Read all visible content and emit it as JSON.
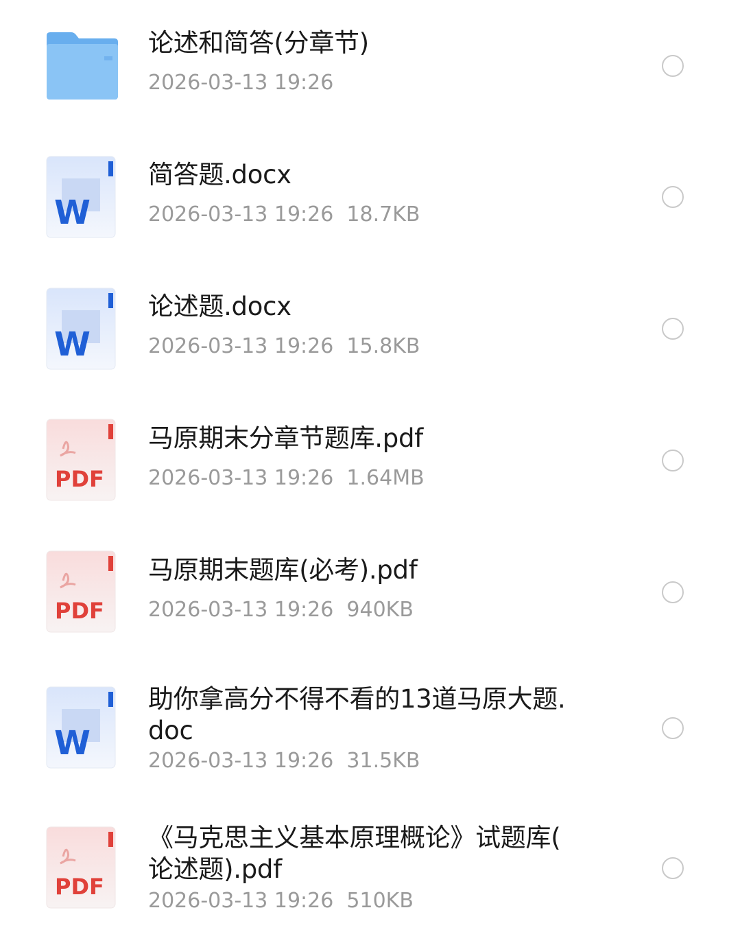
{
  "files": [
    {
      "name": "论述和简答(分章节)",
      "date": "2026-03-13 19:26",
      "size": "",
      "type": "folder",
      "icon": "folder-icon"
    },
    {
      "name": "简答题.docx",
      "date": "2026-03-13 19:26",
      "size": "18.7KB",
      "type": "word",
      "icon": "word-file-icon"
    },
    {
      "name": "论述题.docx",
      "date": "2026-03-13 19:26",
      "size": "15.8KB",
      "type": "word",
      "icon": "word-file-icon"
    },
    {
      "name": "马原期末分章节题库.pdf",
      "date": "2026-03-13 19:26",
      "size": "1.64MB",
      "type": "pdf",
      "icon": "pdf-file-icon"
    },
    {
      "name": "马原期末题库(必考).pdf",
      "date": "2026-03-13 19:26",
      "size": "940KB",
      "type": "pdf",
      "icon": "pdf-file-icon"
    },
    {
      "name": "助你拿高分不得不看的13道马原大题.\ndoc",
      "date": "2026-03-13 19:26",
      "size": "31.5KB",
      "type": "word",
      "icon": "word-file-icon"
    },
    {
      "name": "《马克思主义基本原理概论》试题库(\n论述题).pdf",
      "date": "2026-03-13 19:26",
      "size": "510KB",
      "type": "pdf",
      "icon": "pdf-file-icon"
    }
  ],
  "icon_labels": {
    "word": "W",
    "pdf": "PDF"
  },
  "colors": {
    "folder": "#74b4ef",
    "word": "#1f5fd6",
    "pdf": "#e0413a",
    "radio_border": "#c9c9c9",
    "meta_text": "#9a9a9a"
  }
}
